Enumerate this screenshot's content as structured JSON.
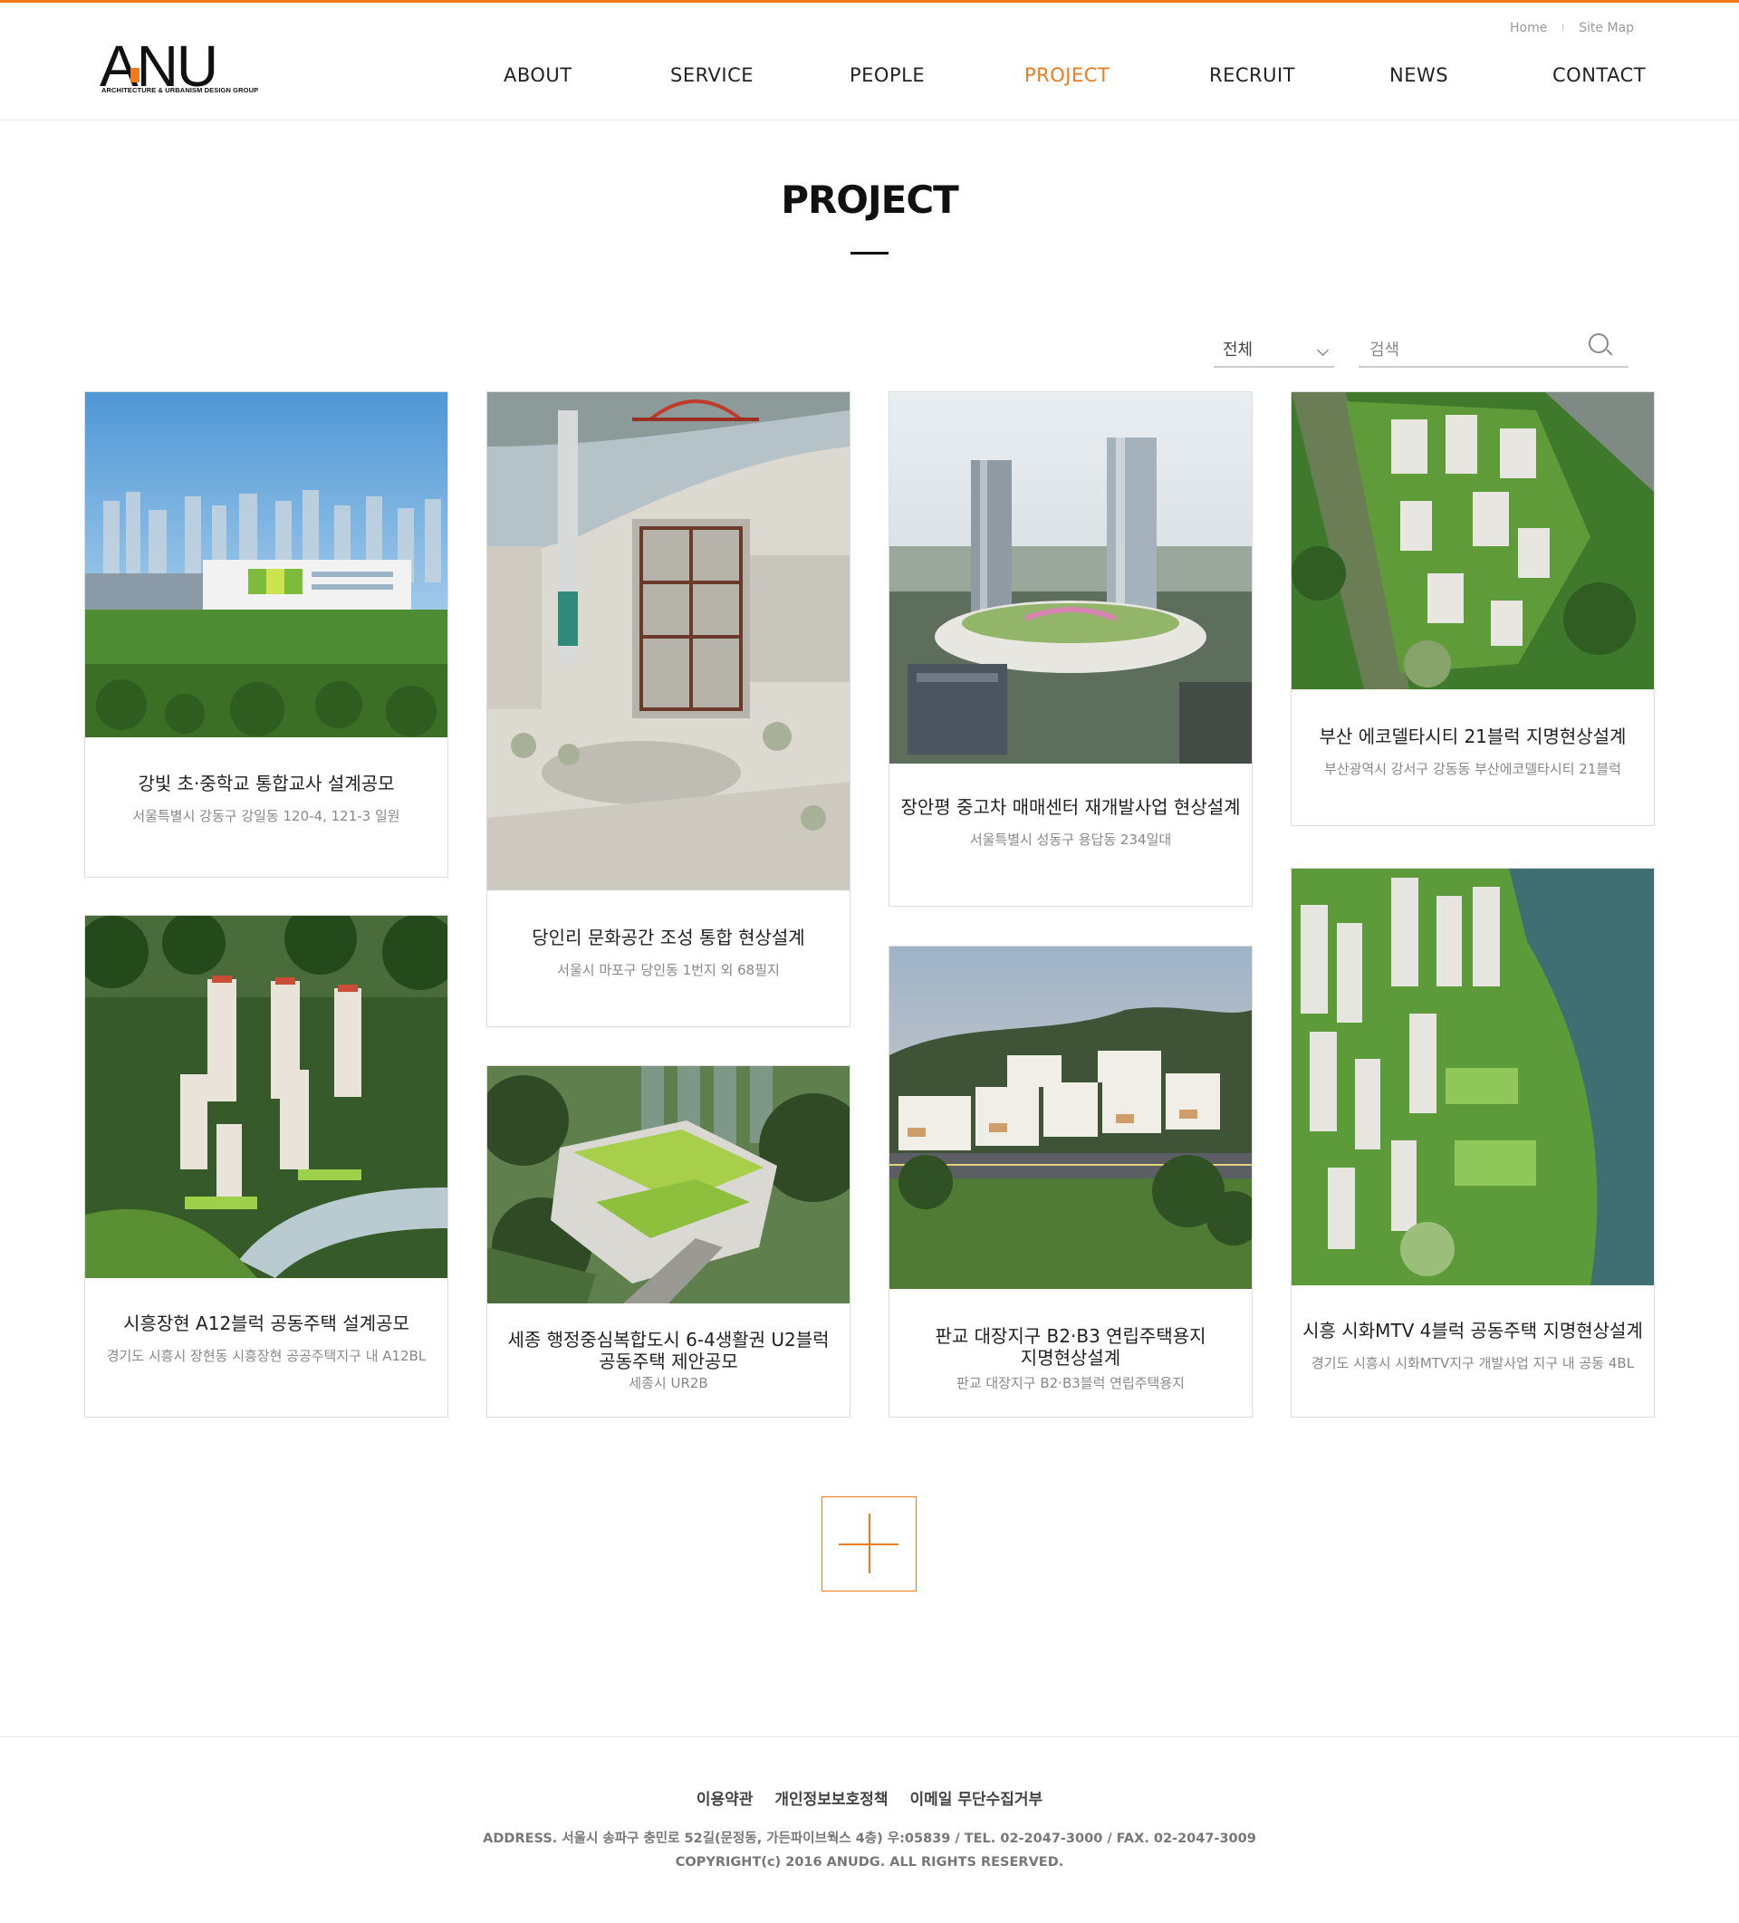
{
  "brand": {
    "logo_text": "ANU",
    "logo_tagline": "ARCHITECTURE & URBANISM DESIGN GROUP",
    "accent_color": "#f07a1e"
  },
  "util_links": {
    "home": "Home",
    "separator": "l",
    "sitemap": "Site Map"
  },
  "nav": [
    {
      "label": "ABOUT",
      "active": false
    },
    {
      "label": "SERVICE",
      "active": false
    },
    {
      "label": "PEOPLE",
      "active": false
    },
    {
      "label": "PROJECT",
      "active": true
    },
    {
      "label": "RECRUIT",
      "active": false
    },
    {
      "label": "NEWS",
      "active": false
    },
    {
      "label": "CONTACT",
      "active": false
    }
  ],
  "page_title": "PROJECT",
  "filter": {
    "selected": "전체",
    "icon": "chevron-down-icon"
  },
  "search": {
    "placeholder": "검색",
    "icon": "search-icon"
  },
  "projects": [
    {
      "title": "강빛 초·중학교 통합교사 설계공모",
      "address": "서울특별시 강동구 강일동 120-4, 121-3 일원",
      "image": "school-campus-rendering"
    },
    {
      "title": "시흥장현 A12블럭 공동주택 설계공모",
      "address": "경기도 시흥시 장현동 시흥장현 공공주택지구 내 A12BL",
      "image": "apartment-towers-riverside"
    },
    {
      "title": "당인리 문화공간 조성 통합 현상설계",
      "address": "서울시 마포구 당인동 1번지 외 68필지",
      "image": "power-plant-cultural-space"
    },
    {
      "title": "세종 행정중심복합도시 6-4생활권 U2블럭\n공동주택 제안공모",
      "address": "세종시 UR2B",
      "image": "green-roof-complex"
    },
    {
      "title": "장안평 중고차 매매센터 재개발사업 현상설계",
      "address": "서울특별시 성동구 용답동 234일대",
      "image": "twin-towers-mall"
    },
    {
      "title": "판교 대장지구 B2·B3 연립주택용지\n지명현상설계",
      "address": "판교 대장지구 B2·B3블럭 연립주택용지",
      "image": "terraced-housing-dusk"
    },
    {
      "title": "부산 에코델타시티 21블럭 지명현상설계",
      "address": "부산광역시 강서구 강동동 부산에코델타시티 21블럭",
      "image": "aerial-apartment-park"
    },
    {
      "title": "시흥 시화MTV 4블럭 공동주택 지명현상설계",
      "address": "경기도 시흥시 시화MTV지구 개발사업 지구 내 공동 4BL",
      "image": "waterfront-towers-aerial"
    }
  ],
  "more_button": {
    "icon": "plus-icon"
  },
  "footer": {
    "links": [
      "이용약관",
      "개인정보보호정책",
      "이메일 무단수집거부"
    ],
    "address": "ADDRESS. 서울시 송파구 충민로 52길(문정동, 가든파이브웍스 4층) 우:05839 /  TEL. 02-2047-3000 / FAX. 02-2047-3009",
    "copyright": "COPYRIGHT(c) 2016 ANUDG. ALL RIGHTS RESERVED."
  }
}
